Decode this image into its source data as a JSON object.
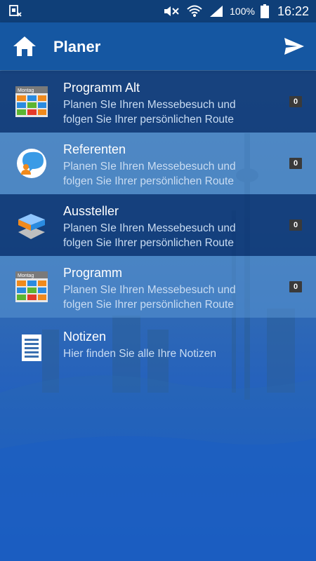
{
  "status_bar": {
    "notification_icon": "sim-error-icon",
    "mute_icon": "mute-icon",
    "wifi_icon": "wifi-icon",
    "signal_icon": "signal-icon",
    "battery_percent": "100%",
    "battery_icon": "battery-icon",
    "time": "16:22"
  },
  "app_bar": {
    "title": "Planer",
    "home_icon": "home-icon",
    "send_icon": "send-icon"
  },
  "list": {
    "items": [
      {
        "title": "Programm Alt",
        "subtitle_line1": "Planen SIe Ihren Messebesuch und",
        "subtitle_line2": "folgen Sie Ihrer persönlichen Route",
        "badge": "0",
        "icon": "calendar-icon",
        "icon_label": "Montag"
      },
      {
        "title": "Referenten",
        "subtitle_line1": "Planen SIe Ihren Messebesuch und",
        "subtitle_line2": "folgen Sie Ihrer persönlichen Route",
        "badge": "0",
        "icon": "speaker-chat-icon"
      },
      {
        "title": "Aussteller",
        "subtitle_line1": "Planen SIe Ihren Messebesuch und",
        "subtitle_line2": "folgen Sie Ihrer persönlichen Route",
        "badge": "0",
        "icon": "booth-icon"
      },
      {
        "title": "Programm",
        "subtitle_line1": "Planen SIe Ihren Messebesuch und",
        "subtitle_line2": "folgen Sie Ihrer persönlichen Route",
        "badge": "0",
        "icon": "calendar-icon",
        "icon_label": "Montag"
      },
      {
        "title": "Notizen",
        "subtitle_line1": "Hier finden Sie alle Ihre Notizen",
        "icon": "notes-icon"
      }
    ]
  },
  "colors": {
    "status_bar": "#0f3f78",
    "app_bar": "#1557a2",
    "badge": "#3a3a3a"
  }
}
